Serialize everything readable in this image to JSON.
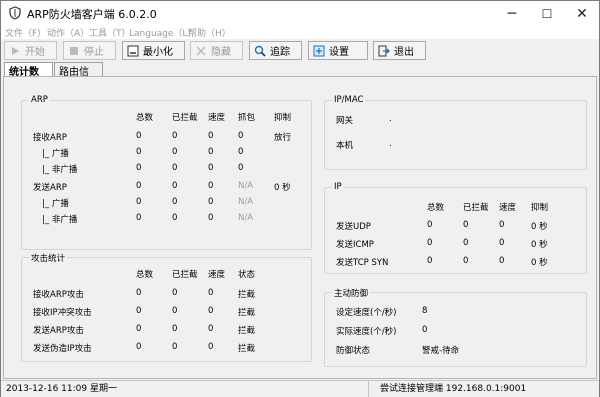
{
  "window": {
    "title": "ARP防火墙客户端 6.0.2.0",
    "minimize": "─",
    "maximize": "☐",
    "close": "✕"
  },
  "menu": [
    "文件（F）",
    "动作（A）",
    "工具（T）",
    "Language（L）",
    "帮助（H）"
  ],
  "toolbar": {
    "start": "开始",
    "stop": "停止",
    "minimize": "最小化",
    "hide": "隐藏",
    "trace": "追踪",
    "settings": "设置",
    "exit": "退出"
  },
  "tabs": [
    "统计数据",
    "路由信息"
  ],
  "arp": {
    "title": "ARP",
    "headers": [
      "总数",
      "已拦截",
      "速度",
      "抓包",
      "抑制"
    ],
    "rows": [
      {
        "label": "接收ARP",
        "vals": [
          "0",
          "0",
          "0",
          "0",
          "放行"
        ]
      },
      {
        "label": "|_ 广播",
        "vals": [
          "0",
          "0",
          "0",
          "0",
          ""
        ]
      },
      {
        "label": "|_ 非广播",
        "vals": [
          "0",
          "0",
          "0",
          "0",
          ""
        ]
      },
      {
        "label": "发送ARP",
        "vals": [
          "0",
          "0",
          "0",
          "N/A",
          "0 秒"
        ]
      },
      {
        "label": "|_ 广播",
        "vals": [
          "0",
          "0",
          "0",
          "N/A",
          ""
        ]
      },
      {
        "label": "|_ 非广播",
        "vals": [
          "0",
          "0",
          "0",
          "N/A",
          ""
        ]
      }
    ]
  },
  "attack": {
    "title": "攻击统计",
    "headers": [
      "总数",
      "已拦截",
      "速度",
      "状态"
    ],
    "rows": [
      {
        "label": "接收ARP攻击",
        "vals": [
          "0",
          "0",
          "0",
          "拦截"
        ]
      },
      {
        "label": "接收IP冲突攻击",
        "vals": [
          "0",
          "0",
          "0",
          "拦截"
        ]
      },
      {
        "label": "发送ARP攻击",
        "vals": [
          "0",
          "0",
          "0",
          "拦截"
        ]
      },
      {
        "label": "发送伪造IP攻击",
        "vals": [
          "0",
          "0",
          "0",
          "拦截"
        ]
      }
    ]
  },
  "ipmac": {
    "title": "IP/MAC",
    "gateway_label": "网关",
    "gateway_value": ".",
    "local_label": "本机",
    "local_value": "."
  },
  "ip": {
    "title": "IP",
    "headers": [
      "总数",
      "已拦截",
      "速度",
      "抑制"
    ],
    "rows": [
      {
        "label": "发送UDP",
        "vals": [
          "0",
          "0",
          "0",
          "0 秒"
        ]
      },
      {
        "label": "发送ICMP",
        "vals": [
          "0",
          "0",
          "0",
          "0 秒"
        ]
      },
      {
        "label": "发送TCP SYN",
        "vals": [
          "0",
          "0",
          "0",
          "0 秒"
        ]
      }
    ]
  },
  "defense": {
    "title": "主动防御",
    "rows": [
      {
        "label": "设定速度(个/秒)",
        "value": "8"
      },
      {
        "label": "实际速度(个/秒)",
        "value": "0"
      },
      {
        "label": "防御状态",
        "value": "警戒-待命"
      }
    ]
  },
  "status": {
    "datetime": "2013-12-16 11:09 星期一",
    "connection": "尝试连接管理端 192.168.0.1:9001"
  },
  "colors": {
    "accent": "#1e6ec8",
    "disabled": "#9a9a9a"
  }
}
